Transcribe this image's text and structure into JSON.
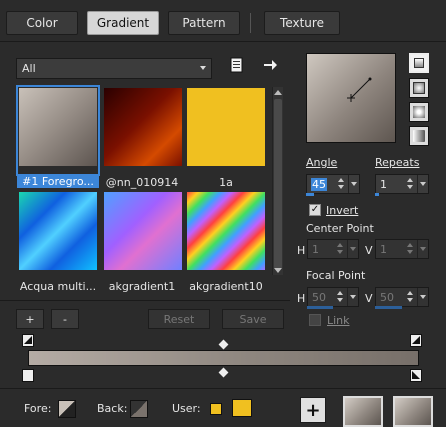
{
  "tabs": [
    {
      "label": "Color",
      "active": false
    },
    {
      "label": "Gradient",
      "active": true
    },
    {
      "label": "Pattern",
      "active": false
    },
    {
      "label": "Texture",
      "active": false
    }
  ],
  "category": {
    "selected": "All"
  },
  "gradients": [
    {
      "name": "#1 Foregro...",
      "selected": true
    },
    {
      "name": "@nn_010914",
      "selected": false
    },
    {
      "name": "1a",
      "selected": false
    },
    {
      "name": "Acqua multi...",
      "selected": false
    },
    {
      "name": "akgradient1",
      "selected": false
    },
    {
      "name": "akgradient10",
      "selected": false
    }
  ],
  "buttons": {
    "add": "+",
    "remove": "-",
    "reset": "Reset",
    "save": "Save"
  },
  "settings": {
    "angle_label": "Angle",
    "angle_value": "45",
    "repeats_label": "Repeats",
    "repeats_value": "1",
    "invert_label": "Invert",
    "invert_checked": true,
    "center_point_label": "Center Point",
    "center_h_label": "H",
    "center_h_value": "1",
    "center_v_label": "V",
    "center_v_value": "1",
    "focal_point_label": "Focal Point",
    "focal_h_label": "H",
    "focal_h_value": "50",
    "focal_v_label": "V",
    "focal_v_value": "50",
    "link_label": "Link"
  },
  "footer": {
    "fore_label": "Fore:",
    "back_label": "Back:",
    "user_label": "User:",
    "add_label": "+"
  },
  "colors": {
    "accent": "#3c86d8",
    "user": "#f0c020"
  }
}
